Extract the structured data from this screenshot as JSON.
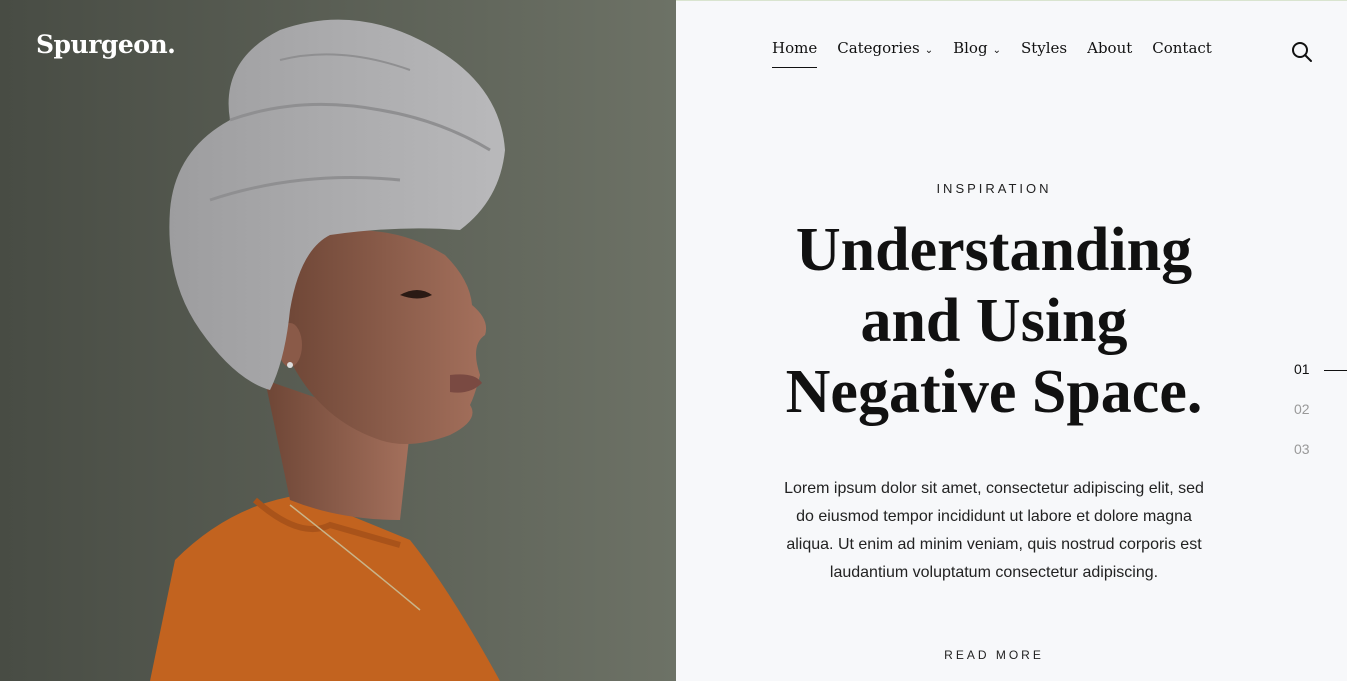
{
  "site": {
    "logo": "Spurgeon."
  },
  "nav": {
    "items": [
      {
        "label": "Home",
        "has_dropdown": false,
        "active": true
      },
      {
        "label": "Categories",
        "has_dropdown": true
      },
      {
        "label": "Blog",
        "has_dropdown": true
      },
      {
        "label": "Styles",
        "has_dropdown": false
      },
      {
        "label": "About",
        "has_dropdown": false
      },
      {
        "label": "Contact",
        "has_dropdown": false
      }
    ],
    "search_icon": "search-icon"
  },
  "hero": {
    "category": "INSPIRATION",
    "title_lines": [
      "Understanding",
      "and Using",
      "Negative Space."
    ],
    "excerpt": "Lorem ipsum dolor sit amet, consectetur adipiscing elit, sed do eiusmod tempor incididunt ut labore et dolore magna aliqua. Ut enim ad minim veniam, quis nostrud corporis est laudantium voluptatum consectetur adipiscing.",
    "read_more": "READ MORE",
    "image_subject": "portrait"
  },
  "pager": {
    "items": [
      "01",
      "02",
      "03"
    ],
    "active_index": 0
  },
  "colors": {
    "panel_bg": "#f7f8fa",
    "text": "#111111",
    "muted": "#999999",
    "photo_bg": "#5c6158",
    "sweater": "#c2631f",
    "turban": "#a6a6a8"
  }
}
